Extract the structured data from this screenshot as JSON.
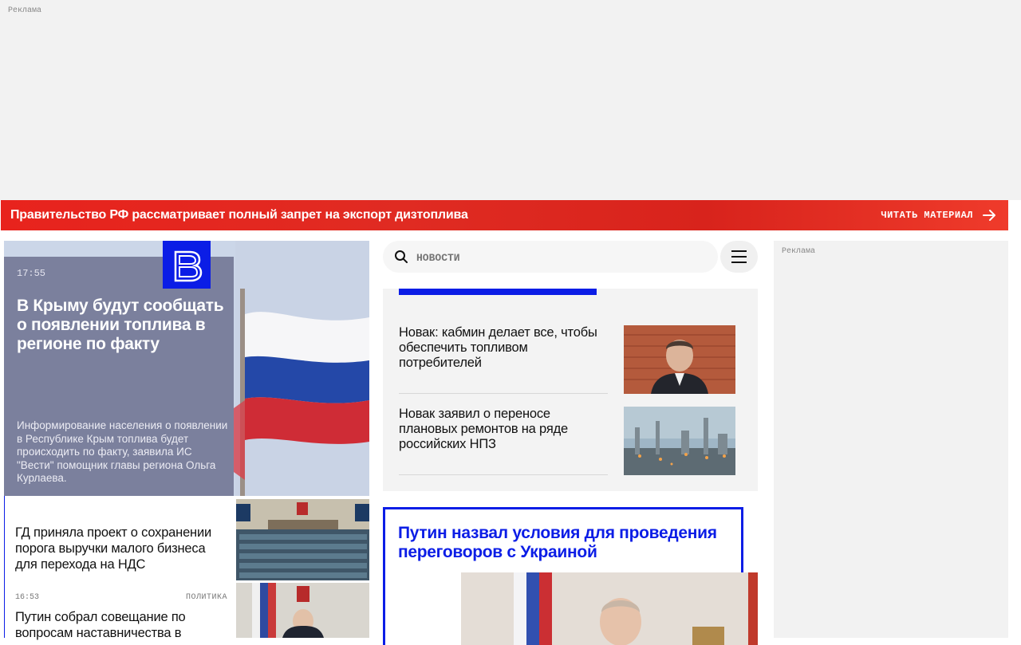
{
  "ads": {
    "top_label": "Реклама",
    "right_label": "Реклама"
  },
  "banner": {
    "title": "Правительство РФ рассматривает полный запрет на экспорт дизтоплива",
    "cta": "ЧИТАТЬ МАТЕРИАЛ",
    "cta_icon": "arrow-right-icon"
  },
  "logo": {
    "icon": "vesti-logo"
  },
  "hero": {
    "time": "17:55",
    "title": "В Крыму будут сообщать о появлении топлива в регионе по факту",
    "lead": "Информирование населения о появлении в Республике Крым топлива будет происходить по факту, заявила ИС \"Вести\" помощник главы региона Ольга Курлаева."
  },
  "left_news": [
    {
      "title": "ГД приняла проект о сохранении порога выручки малого бизнеса для перехода на НДС"
    },
    {
      "time": "16:53",
      "rubric": "ПОЛИТИКА",
      "title": "Путин собрал совещание по вопросам наставничества в"
    }
  ],
  "search": {
    "placeholder": "НОВОСТИ",
    "icon": "search-icon"
  },
  "menu": {
    "icon": "hamburger-icon"
  },
  "feature_items": [
    {
      "title": "Новак: кабмин делает все, чтобы обеспечить топливом потребителей"
    },
    {
      "title": "Новак заявил о переносе плановых ремонтов на ряде российских НПЗ"
    }
  ],
  "main_story": {
    "title": "Путин назвал условия для проведения переговоров с Украиной"
  },
  "colors": {
    "accent": "#0b1de6",
    "banner": "#e02b22"
  }
}
